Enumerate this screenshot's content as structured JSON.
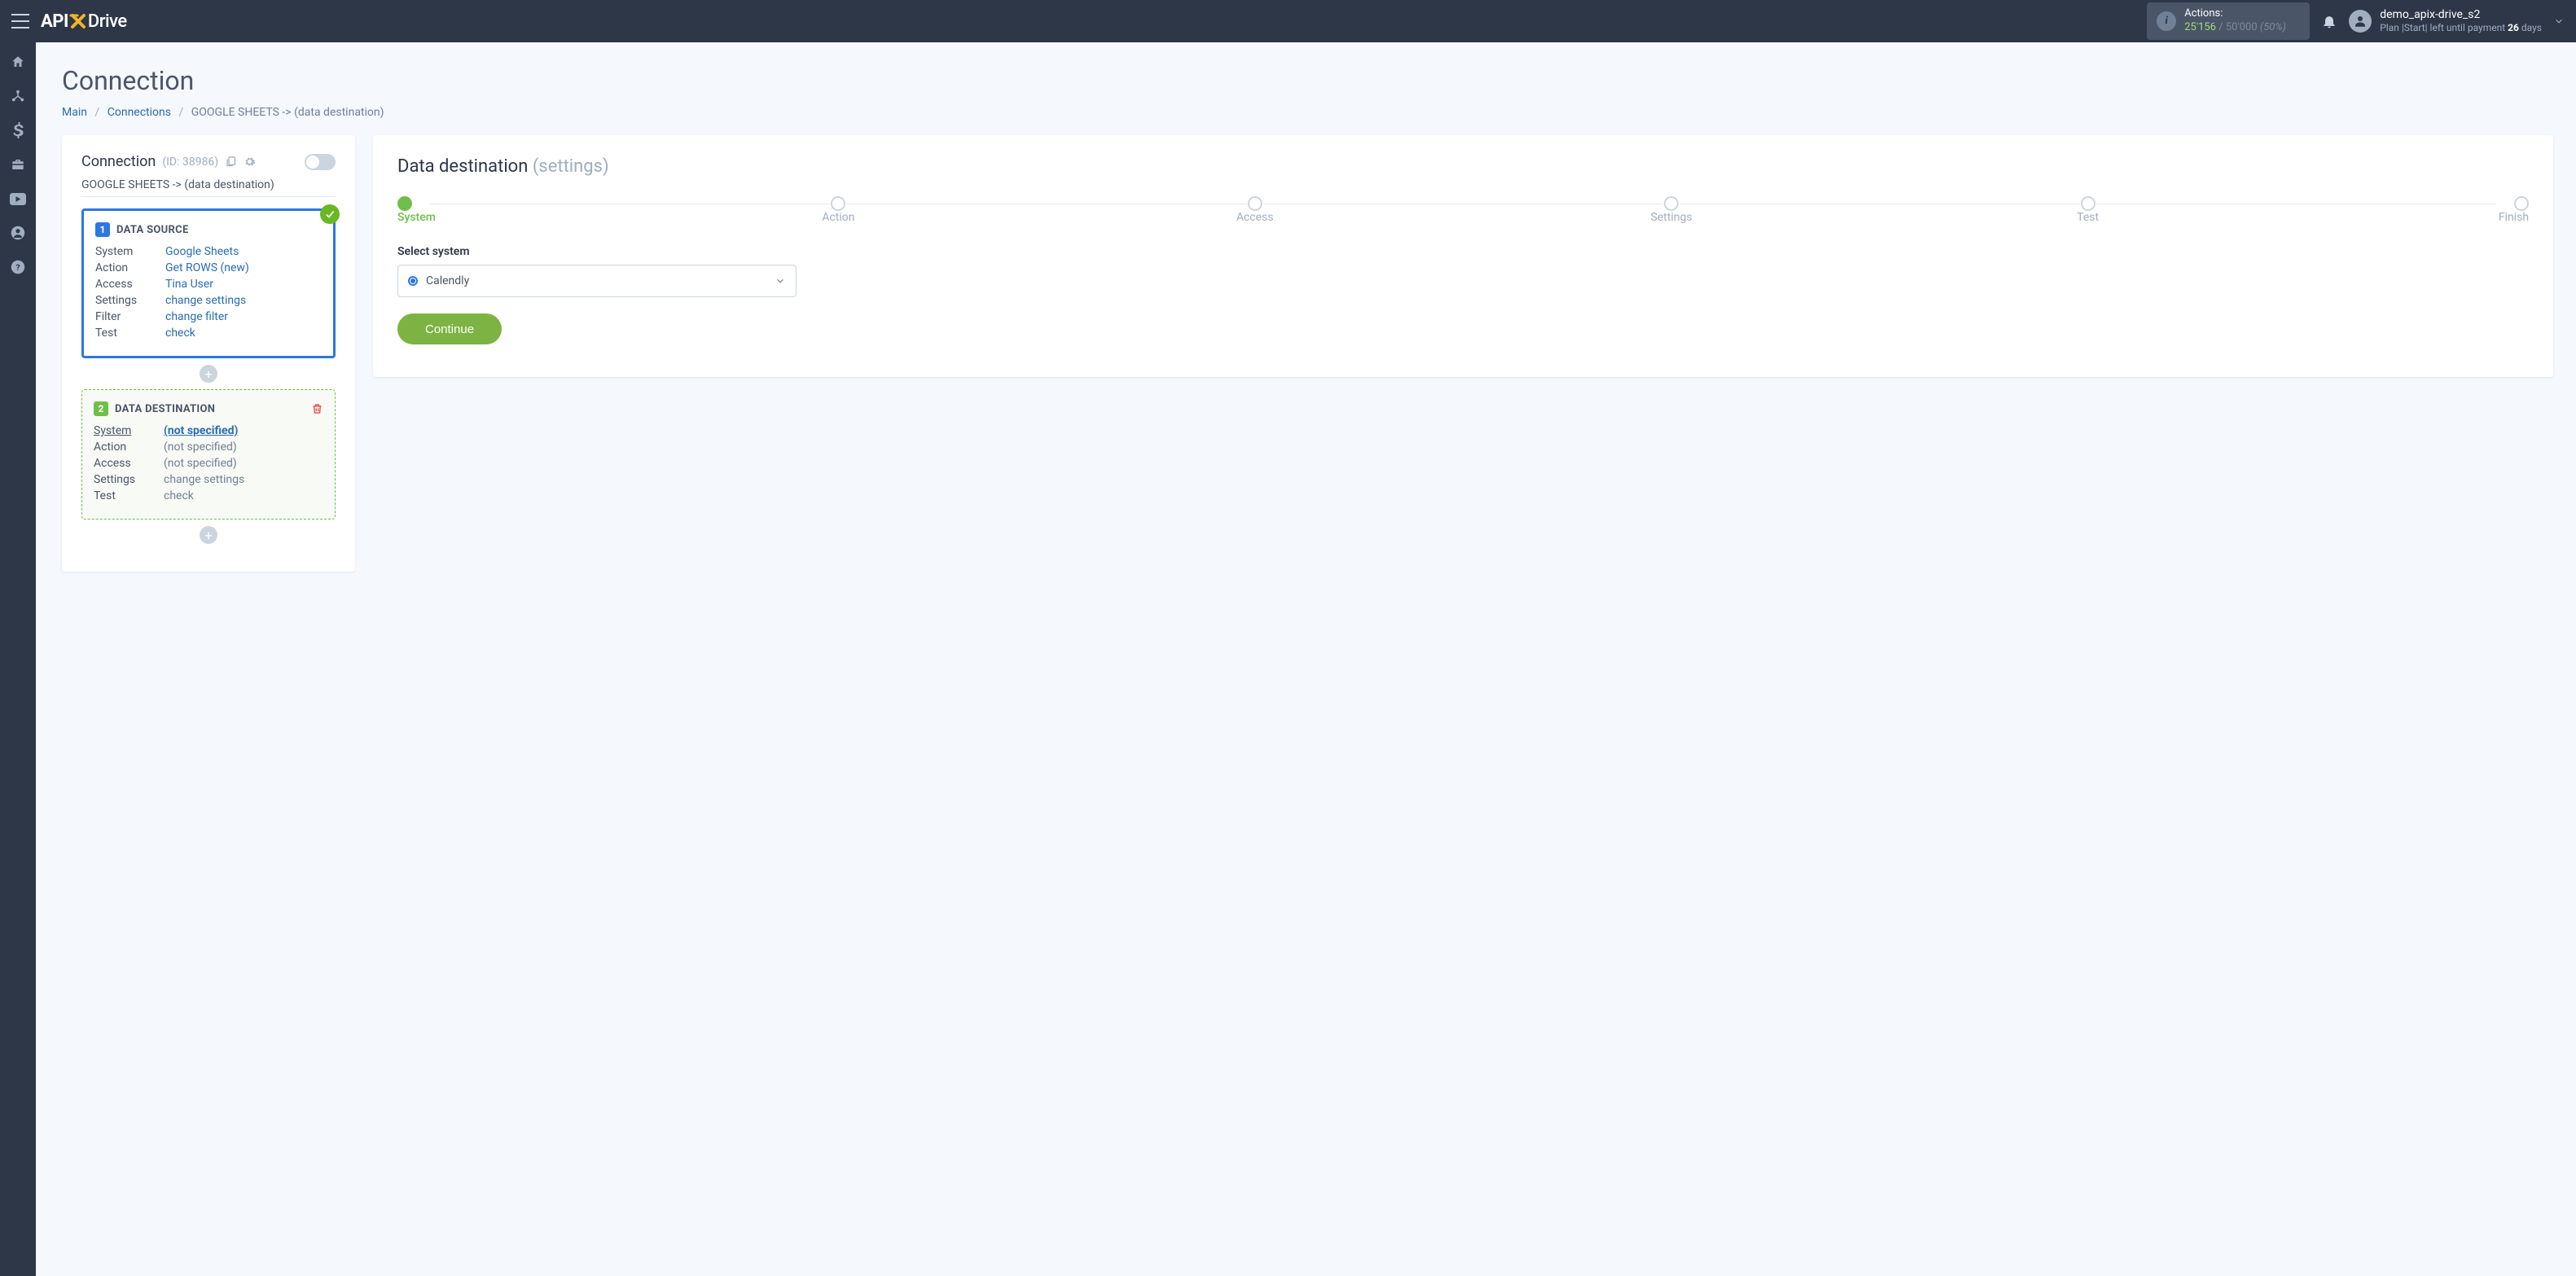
{
  "header": {
    "logo_api": "API",
    "logo_drive": "Drive",
    "actions_label": "Actions:",
    "actions_used": "25'156",
    "actions_sep": " / ",
    "actions_total": "50'000",
    "actions_pct": "(50%)",
    "user_name": "demo_apix-drive_s2",
    "user_plan_prefix": "Plan |Start| left until payment ",
    "user_plan_days": "26",
    "user_plan_suffix": " days"
  },
  "page": {
    "title": "Connection",
    "crumb_main": "Main",
    "crumb_connections": "Connections",
    "crumb_current": "GOOGLE SHEETS -> (data destination)"
  },
  "left": {
    "title": "Connection",
    "id_label": "(ID: 38986)",
    "name": "GOOGLE SHEETS -> (data destination)",
    "source": {
      "badge": "1",
      "title": "DATA SOURCE",
      "rows": [
        {
          "k": "System",
          "v": "Google Sheets",
          "link": true
        },
        {
          "k": "Action",
          "v": "Get ROWS (new)",
          "link": true
        },
        {
          "k": "Access",
          "v": "Tina User",
          "link": true
        },
        {
          "k": "Settings",
          "v": "change settings",
          "link": true
        },
        {
          "k": "Filter",
          "v": "change filter",
          "link": true
        },
        {
          "k": "Test",
          "v": "check",
          "link": true
        }
      ]
    },
    "dest": {
      "badge": "2",
      "title": "DATA DESTINATION",
      "rows": [
        {
          "k": "System",
          "v": "(not specified)",
          "ku": true,
          "bold": true
        },
        {
          "k": "Action",
          "v": "(not specified)",
          "muted": true
        },
        {
          "k": "Access",
          "v": "(not specified)",
          "muted": true
        },
        {
          "k": "Settings",
          "v": "change settings",
          "muted": true
        },
        {
          "k": "Test",
          "v": "check",
          "muted": true
        }
      ]
    }
  },
  "right": {
    "title": "Data destination",
    "subtitle": "(settings)",
    "steps": [
      "System",
      "Action",
      "Access",
      "Settings",
      "Test",
      "Finish"
    ],
    "active_step": 0,
    "select_label": "Select system",
    "select_value": "Calendly",
    "continue": "Continue"
  }
}
